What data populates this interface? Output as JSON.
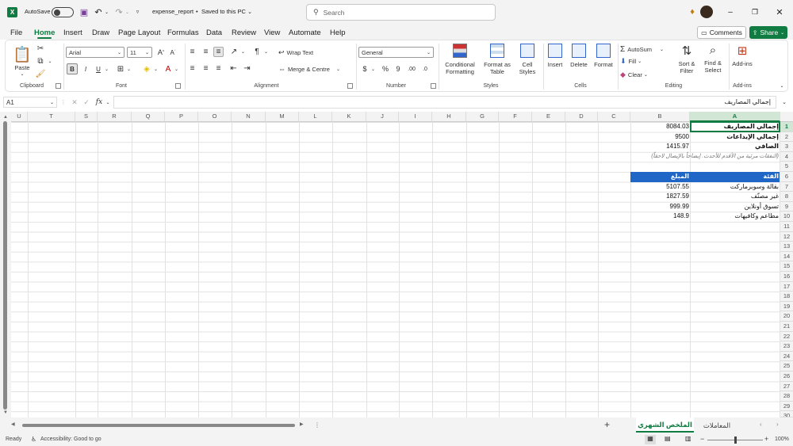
{
  "titlebar": {
    "autosave_label": "AutoSave",
    "autosave_state": "Off",
    "file_name": "expense_report",
    "save_status": "Saved to this PC",
    "search_placeholder": "Search"
  },
  "ribbon_tabs": [
    "File",
    "Home",
    "Insert",
    "Draw",
    "Page Layout",
    "Formulas",
    "Data",
    "Review",
    "View",
    "Automate",
    "Help"
  ],
  "active_tab": "Home",
  "actions": {
    "comments": "Comments",
    "share": "Share"
  },
  "clipboard": {
    "paste": "Paste",
    "label": "Clipboard"
  },
  "font": {
    "name": "Arial",
    "size": "11",
    "label": "Font",
    "bold": "B",
    "italic": "I",
    "underline": "U"
  },
  "alignment": {
    "wrap": "Wrap Text",
    "merge": "Merge & Centre",
    "label": "Alignment"
  },
  "number": {
    "format": "General",
    "label": "Number",
    "currency": "$",
    "percent": "%",
    "comma": "9"
  },
  "styles": {
    "conditional": [
      "Conditional",
      "Formatting"
    ],
    "format_as": [
      "Format as",
      "Table"
    ],
    "cell": [
      "Cell",
      "Styles"
    ],
    "label": "Styles"
  },
  "cells": {
    "insert": "Insert",
    "delete": "Delete",
    "format": "Format",
    "label": "Cells"
  },
  "editing": {
    "autosum": "AutoSum",
    "fill": "Fill",
    "clear": "Clear",
    "sort": [
      "Sort &",
      "Filter"
    ],
    "find": [
      "Find &",
      "Select"
    ],
    "label": "Editing"
  },
  "addins": {
    "label_top": "Add-ins",
    "label": "Add-ins"
  },
  "formula_bar": {
    "name_box": "A1",
    "fx": "fx",
    "content": "إجمالي المصاريف"
  },
  "columns": [
    "U",
    "T",
    "S",
    "R",
    "Q",
    "P",
    "O",
    "N",
    "M",
    "L",
    "K",
    "J",
    "I",
    "H",
    "G",
    "F",
    "E",
    "D",
    "C",
    "B",
    "A"
  ],
  "rows": [
    "1",
    "2",
    "3",
    "4",
    "5",
    "6",
    "7",
    "8",
    "9",
    "10",
    "11",
    "12",
    "13",
    "14",
    "15",
    "16",
    "17",
    "18",
    "19",
    "20",
    "21",
    "22",
    "23",
    "24",
    "25",
    "26",
    "27",
    "28",
    "29",
    "30"
  ],
  "cells_data": {
    "a1": "إجمالي المصاريف",
    "b1": "8084.03",
    "a2": "إجمالي الإيداعات",
    "b2": "9500",
    "a3": "الصافي",
    "b3": "1415.97",
    "a4": "(النفقات مرئية من الأقدم للأحدث. إيضاحاً بالإيصال لاحقاً)",
    "a6": "الفئة",
    "b6": "المبلغ",
    "a7": "بقالة وسوبرماركت",
    "b7": "5107.55",
    "a8": "غير مصنّف",
    "b8": "1827.59",
    "a9": "تسوق أونلاين",
    "b9": "999.99",
    "a10": "مطاعم وكافيهات",
    "b10": "148.9"
  },
  "sheets": {
    "active": "الملخص الشهري",
    "other": "المعاملات",
    "add": "+"
  },
  "status": {
    "ready": "Ready",
    "accessibility": "Accessibility: Good to go",
    "zoom": "100%"
  },
  "colors": {
    "accent_green": "#107c41",
    "header_fill": "#1f66c7",
    "header_text": "#ffffff"
  }
}
